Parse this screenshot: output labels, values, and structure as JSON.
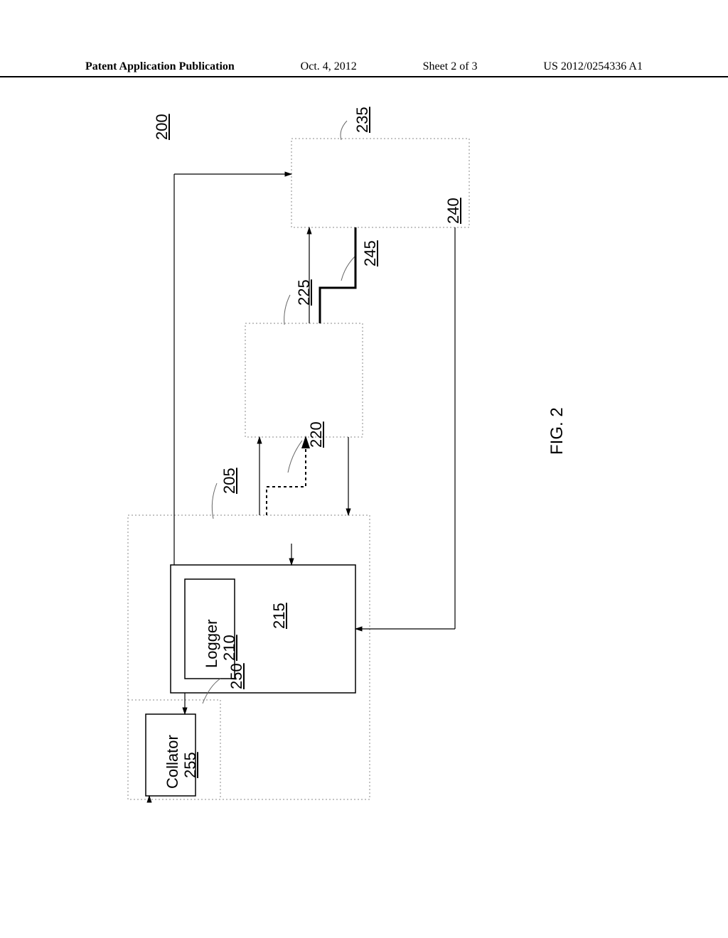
{
  "header": {
    "left": "Patent Application Publication",
    "date": "Oct. 4, 2012",
    "sheet": "Sheet 2 of 3",
    "pubnum": "US 2012/0254336 A1"
  },
  "figure": {
    "label": "FIG. 2",
    "diagram_id": "200",
    "blocks": {
      "logger": {
        "name": "Logger",
        "ref": "210"
      },
      "collator": {
        "name": "Collator",
        "ref": "255"
      }
    },
    "refs": {
      "r200": "200",
      "r205": "205",
      "r215": "215",
      "r220": "220",
      "r225": "225",
      "r235": "235",
      "r240": "240",
      "r245": "245",
      "r250": "250"
    }
  }
}
